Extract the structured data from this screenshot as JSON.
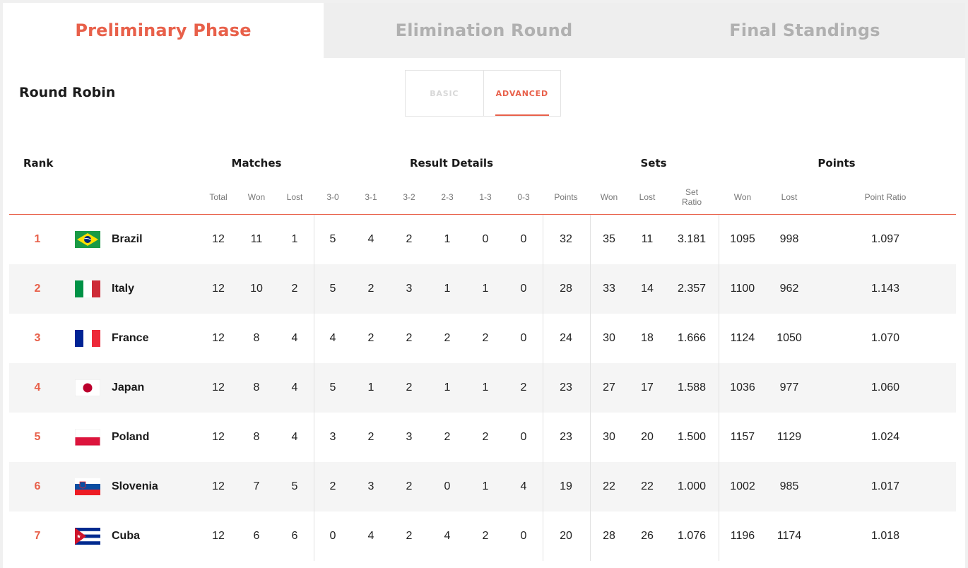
{
  "phase_tabs": [
    {
      "label": "Preliminary Phase",
      "active": true
    },
    {
      "label": "Elimination Round",
      "active": false
    },
    {
      "label": "Final Standings",
      "active": false
    }
  ],
  "section_title": "Round Robin",
  "view_toggle": {
    "basic": "BASIC",
    "advanced": "ADVANCED",
    "selected": "advanced"
  },
  "accent_color": "#e8604a",
  "table": {
    "groups": {
      "rank": "Rank",
      "matches": "Matches",
      "result_details": "Result Details",
      "sets": "Sets",
      "points": "Points"
    },
    "columns": {
      "total": "Total",
      "won": "Won",
      "lost": "Lost",
      "r30": "3-0",
      "r31": "3-1",
      "r32": "3-2",
      "r23": "2-3",
      "r13": "1-3",
      "r03": "0-3",
      "points": "Points",
      "sets_won": "Won",
      "sets_lost": "Lost",
      "set_ratio": "Set Ratio",
      "pts_won": "Won",
      "pts_lost": "Lost",
      "point_ratio": "Point Ratio"
    },
    "rows": [
      {
        "rank": "1",
        "team": "Brazil",
        "flag": "brazil-flag-icon",
        "total": "12",
        "won": "11",
        "lost": "1",
        "r30": "5",
        "r31": "4",
        "r32": "2",
        "r23": "1",
        "r13": "0",
        "r03": "0",
        "points": "32",
        "sets_won": "35",
        "sets_lost": "11",
        "set_ratio": "3.181",
        "pts_won": "1095",
        "pts_lost": "998",
        "point_ratio": "1.097"
      },
      {
        "rank": "2",
        "team": "Italy",
        "flag": "italy-flag-icon",
        "total": "12",
        "won": "10",
        "lost": "2",
        "r30": "5",
        "r31": "2",
        "r32": "3",
        "r23": "1",
        "r13": "1",
        "r03": "0",
        "points": "28",
        "sets_won": "33",
        "sets_lost": "14",
        "set_ratio": "2.357",
        "pts_won": "1100",
        "pts_lost": "962",
        "point_ratio": "1.143"
      },
      {
        "rank": "3",
        "team": "France",
        "flag": "france-flag-icon",
        "total": "12",
        "won": "8",
        "lost": "4",
        "r30": "4",
        "r31": "2",
        "r32": "2",
        "r23": "2",
        "r13": "2",
        "r03": "0",
        "points": "24",
        "sets_won": "30",
        "sets_lost": "18",
        "set_ratio": "1.666",
        "pts_won": "1124",
        "pts_lost": "1050",
        "point_ratio": "1.070"
      },
      {
        "rank": "4",
        "team": "Japan",
        "flag": "japan-flag-icon",
        "total": "12",
        "won": "8",
        "lost": "4",
        "r30": "5",
        "r31": "1",
        "r32": "2",
        "r23": "1",
        "r13": "1",
        "r03": "2",
        "points": "23",
        "sets_won": "27",
        "sets_lost": "17",
        "set_ratio": "1.588",
        "pts_won": "1036",
        "pts_lost": "977",
        "point_ratio": "1.060"
      },
      {
        "rank": "5",
        "team": "Poland",
        "flag": "poland-flag-icon",
        "total": "12",
        "won": "8",
        "lost": "4",
        "r30": "3",
        "r31": "2",
        "r32": "3",
        "r23": "2",
        "r13": "2",
        "r03": "0",
        "points": "23",
        "sets_won": "30",
        "sets_lost": "20",
        "set_ratio": "1.500",
        "pts_won": "1157",
        "pts_lost": "1129",
        "point_ratio": "1.024"
      },
      {
        "rank": "6",
        "team": "Slovenia",
        "flag": "slovenia-flag-icon",
        "total": "12",
        "won": "7",
        "lost": "5",
        "r30": "2",
        "r31": "3",
        "r32": "2",
        "r23": "0",
        "r13": "1",
        "r03": "4",
        "points": "19",
        "sets_won": "22",
        "sets_lost": "22",
        "set_ratio": "1.000",
        "pts_won": "1002",
        "pts_lost": "985",
        "point_ratio": "1.017"
      },
      {
        "rank": "7",
        "team": "Cuba",
        "flag": "cuba-flag-icon",
        "total": "12",
        "won": "6",
        "lost": "6",
        "r30": "0",
        "r31": "4",
        "r32": "2",
        "r23": "4",
        "r13": "2",
        "r03": "0",
        "points": "20",
        "sets_won": "28",
        "sets_lost": "26",
        "set_ratio": "1.076",
        "pts_won": "1196",
        "pts_lost": "1174",
        "point_ratio": "1.018"
      }
    ]
  }
}
